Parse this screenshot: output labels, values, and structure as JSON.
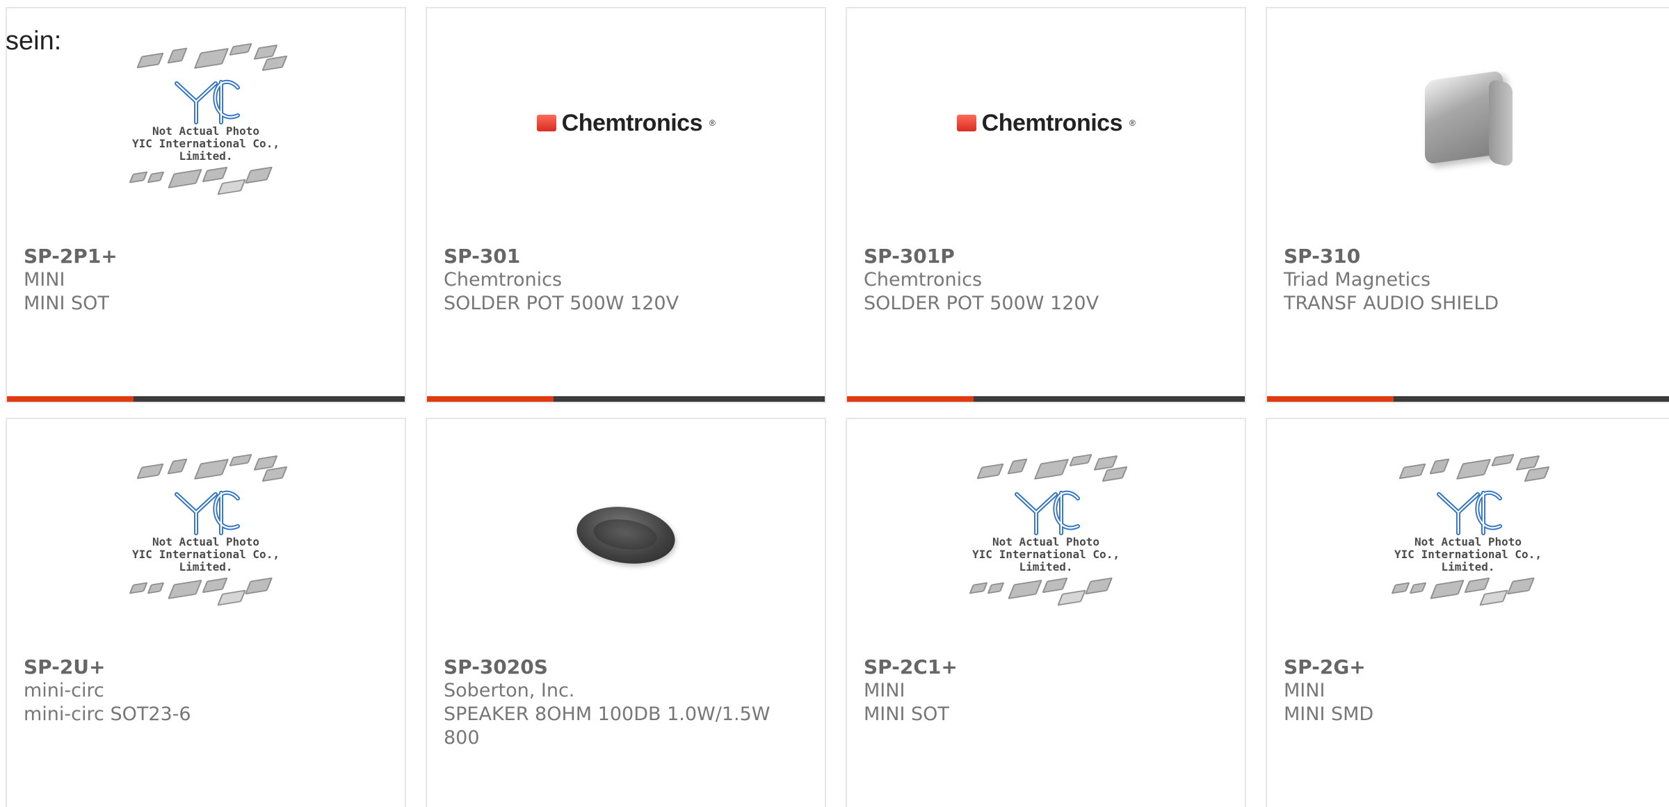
{
  "top_text": "sein:",
  "colors": {
    "accent": "#e03a12",
    "bar_base": "#3b3b3b",
    "part_text": "#666666",
    "meta_text": "#777777",
    "yic_blue": "#2f73c9"
  },
  "yic_placeholder": {
    "caption_line1": "Not Actual Photo",
    "caption_line2": "YIC International Co., Limited.",
    "logo_text": "YIC"
  },
  "brand_logo": {
    "chemtronics": "Chemtronics",
    "registered": "®"
  },
  "products": [
    {
      "part_number": "SP-2P1+",
      "manufacturer": "MINI",
      "description": "MINI SOT",
      "image": "yic-placeholder-icon"
    },
    {
      "part_number": "SP-301",
      "manufacturer": "Chemtronics",
      "description": "SOLDER POT 500W 120V",
      "image": "chemtronics-logo-icon"
    },
    {
      "part_number": "SP-301P",
      "manufacturer": "Chemtronics",
      "description": "SOLDER POT 500W 120V",
      "image": "chemtronics-logo-icon"
    },
    {
      "part_number": "SP-310",
      "manufacturer": "Triad Magnetics",
      "description": "TRANSF AUDIO SHIELD",
      "image": "metal-cap-icon"
    },
    {
      "part_number": "SP-2U+",
      "manufacturer": "mini-circ",
      "description": "mini-circ SOT23-6",
      "image": "yic-placeholder-icon"
    },
    {
      "part_number": "SP-3020S",
      "manufacturer": "Soberton, Inc.",
      "description": "SPEAKER 8OHM 100DB 1.0W/1.5W 800",
      "image": "speaker-icon"
    },
    {
      "part_number": "SP-2C1+",
      "manufacturer": "MINI",
      "description": "MINI SOT",
      "image": "yic-placeholder-icon"
    },
    {
      "part_number": "SP-2G+",
      "manufacturer": "MINI",
      "description": "MINI SMD",
      "image": "yic-placeholder-icon"
    }
  ]
}
